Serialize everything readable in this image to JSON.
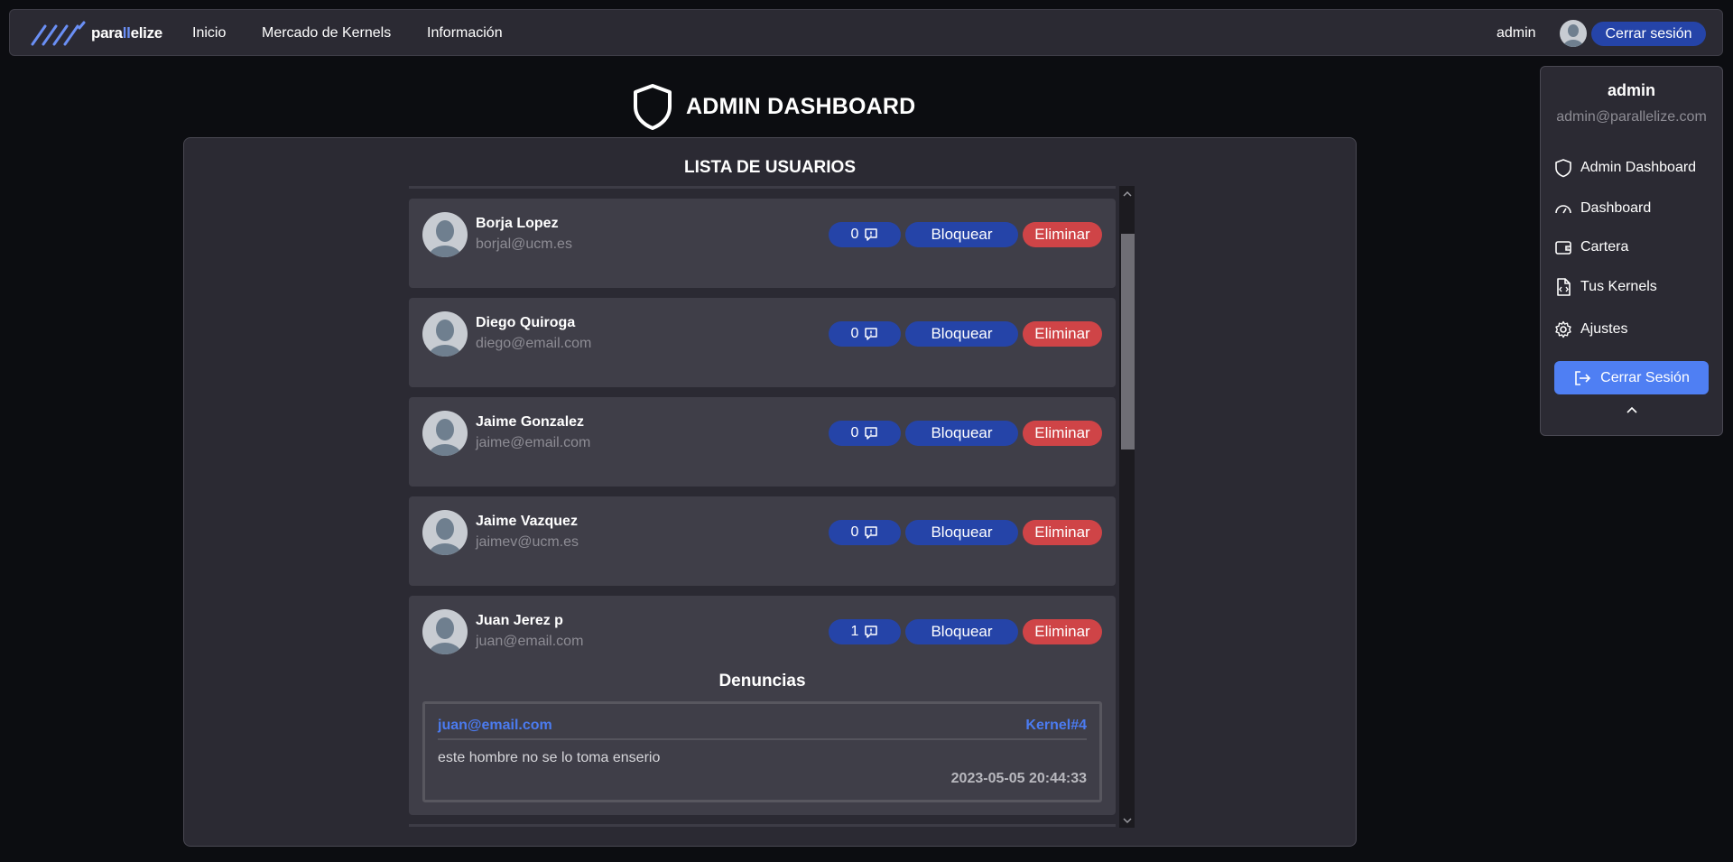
{
  "navbar": {
    "logo_prefix": "para",
    "logo_highlight": "ll",
    "logo_suffix": "elize",
    "links": [
      "Inicio",
      "Mercado de Kernels",
      "Información"
    ],
    "user": "admin",
    "logout_label": "Cerrar sesión"
  },
  "page": {
    "title": "ADMIN DASHBOARD"
  },
  "users_panel": {
    "title": "LISTA DE USUARIOS",
    "block_label": "Bloquear",
    "delete_label": "Eliminar",
    "users": [
      {
        "name": "Borja Lopez",
        "email": "borjal@ucm.es",
        "reports": "0"
      },
      {
        "name": "Diego Quiroga",
        "email": "diego@email.com",
        "reports": "0"
      },
      {
        "name": "Jaime Gonzalez",
        "email": "jaime@email.com",
        "reports": "0"
      },
      {
        "name": "Jaime Vazquez",
        "email": "jaimev@ucm.es",
        "reports": "0"
      },
      {
        "name": "Juan Jerez p",
        "email": "juan@email.com",
        "reports": "1"
      }
    ],
    "reports_section": {
      "title": "Denuncias",
      "report": {
        "reporter": "juan@email.com",
        "kernel": "Kernel#4",
        "text": "este hombre no se lo toma enserio",
        "date": "2023-05-05 20:44:33"
      }
    }
  },
  "dropdown": {
    "name": "admin",
    "email": "admin@parallelize.com",
    "items": [
      {
        "label": "Admin Dashboard",
        "icon": "shield-icon"
      },
      {
        "label": "Dashboard",
        "icon": "gauge-icon"
      },
      {
        "label": "Cartera",
        "icon": "wallet-icon"
      },
      {
        "label": "Tus Kernels",
        "icon": "code-file-icon"
      },
      {
        "label": "Ajustes",
        "icon": "gear-icon"
      }
    ],
    "logout_label": "Cerrar Sesión"
  },
  "colors": {
    "accent_blue": "#2544a8",
    "button_blue": "#4f7ff3",
    "danger_red": "#cf4447",
    "link_blue": "#4b7bf0"
  }
}
